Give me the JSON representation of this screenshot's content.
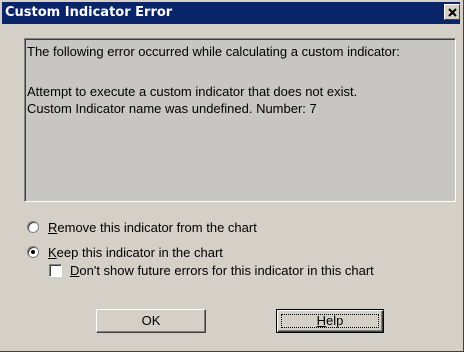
{
  "window": {
    "title": "Custom Indicator Error"
  },
  "message": {
    "line1": "The following error occurred while calculating a custom indicator:",
    "line2": "Attempt to execute a custom indicator that does not exist.",
    "line3": "Custom Indicator name was undefined.  Number: 7"
  },
  "options": {
    "remove": {
      "prefix": "",
      "accel": "R",
      "rest": "emove this indicator from the chart",
      "selected": false
    },
    "keep": {
      "prefix": "",
      "accel": "K",
      "rest": "eep this indicator in the chart",
      "selected": true
    },
    "dont_show": {
      "prefix": "",
      "accel": "D",
      "rest": "on't show future errors for this indicator in this chart",
      "checked": false
    }
  },
  "buttons": {
    "ok": {
      "label": "OK"
    },
    "help": {
      "accel": "H",
      "rest": "elp"
    }
  },
  "colors": {
    "title_bar": "#0a246a",
    "face": "#d4d0c8"
  }
}
